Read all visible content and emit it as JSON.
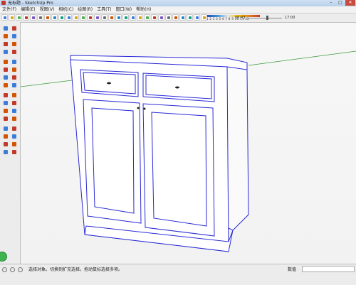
{
  "window": {
    "title": "无标题 - SketchUp Pro",
    "minimize": "–",
    "maximize": "□",
    "close": "✕"
  },
  "menu": {
    "items": [
      "文件(F)",
      "编辑(E)",
      "视图(V)",
      "相机(C)",
      "绘图(R)",
      "工具(T)",
      "窗口(W)",
      "帮助(H)"
    ]
  },
  "toolbar": {
    "buttons": [
      "new-file-icon",
      "open-icon",
      "save-icon",
      "cut-icon",
      "copy-icon",
      "paste-icon",
      "erase-icon",
      "undo-icon",
      "redo-icon",
      "print-icon",
      "user-icon",
      "orbit-icon",
      "pan-icon",
      "zoom-icon",
      "zoom-extents-icon",
      "iso-icon",
      "top-icon",
      "front-icon",
      "right-icon",
      "back-icon",
      "left-icon",
      "xray-icon",
      "backedges-icon",
      "wireframe-icon",
      "hiddenline-icon",
      "shaded-icon",
      "textured-icon",
      "monochrome-icon",
      "shadows-icon"
    ],
    "shadow_scale": "1 2 3 4 5 6 7 8 9 10 11 12",
    "time_left": "06:43",
    "time_right": "17:00",
    "time_slider_fraction": 0.55
  },
  "left_tools": {
    "items": [
      "select-icon",
      "component-icon",
      "paint-bucket-icon",
      "eraser-icon",
      "rectangle-icon",
      "line-icon",
      "circle-icon",
      "arc-icon",
      "polygon-icon",
      "freehand-icon",
      "move-icon",
      "push-pull-icon",
      "rotate-icon",
      "follow-me-icon",
      "scale-icon",
      "offset-icon",
      "tape-measure-icon",
      "dimension-icon",
      "protractor-icon",
      "text-icon",
      "axes-icon",
      "3d-text-icon",
      "orbit-icon",
      "pan-icon",
      "zoom-icon",
      "zoom-window-icon",
      "zoom-extents-icon",
      "previous-view-icon",
      "position-camera-icon",
      "look-around-icon",
      "walk-icon",
      "section-plane-icon"
    ]
  },
  "status": {
    "hint": "选择对象。切换到扩充选择。拖动鼠标选择多项。",
    "value_label": "数值",
    "value": ""
  },
  "colors": {
    "selection_blue": "#2a2ad6",
    "axis_green": "#3a9a3a",
    "axis_red": "#c0392b",
    "sky": "#f5f5f5"
  }
}
